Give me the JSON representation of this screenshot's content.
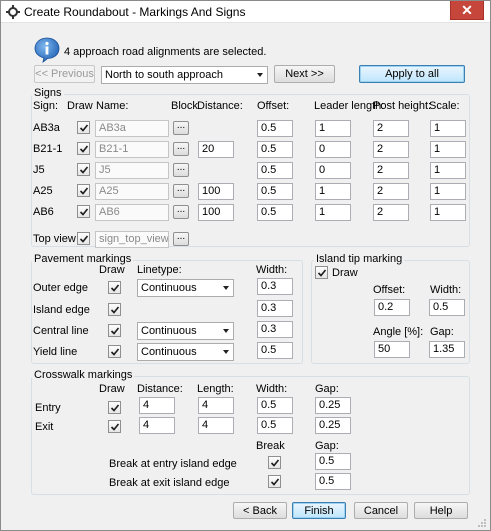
{
  "window": {
    "title": "Create Roundabout - Markings And Signs",
    "close_glyph": "✕"
  },
  "info": {
    "message": "4  approach road alignments are selected."
  },
  "nav": {
    "previous_label": "<< Previous",
    "approach_selected": "North to south approach",
    "next_label": "Next >>",
    "apply_all_label": "Apply to all"
  },
  "signs": {
    "title": "Signs",
    "headers": {
      "sign": "Sign:",
      "draw": "Draw",
      "name": "Name:",
      "block": "Block",
      "distance": "Distance:",
      "offset": "Offset:",
      "leader_length": "Leader length:",
      "post_height": "Post height:",
      "scale": "Scale:"
    },
    "rows": [
      {
        "sign": "AB3a",
        "draw": true,
        "name": "AB3a",
        "distance": "",
        "offset": "0.5",
        "leader_length": "1",
        "post_height": "2",
        "scale": "1"
      },
      {
        "sign": "B21-1",
        "draw": true,
        "name": "B21-1",
        "distance": "20",
        "offset": "0.5",
        "leader_length": "0",
        "post_height": "2",
        "scale": "1"
      },
      {
        "sign": "J5",
        "draw": true,
        "name": "J5",
        "distance": "",
        "offset": "0.5",
        "leader_length": "0",
        "post_height": "2",
        "scale": "1"
      },
      {
        "sign": "A25",
        "draw": true,
        "name": "A25",
        "distance": "100",
        "offset": "0.5",
        "leader_length": "1",
        "post_height": "2",
        "scale": "1"
      },
      {
        "sign": "AB6",
        "draw": true,
        "name": "AB6",
        "distance": "100",
        "offset": "0.5",
        "leader_length": "1",
        "post_height": "2",
        "scale": "1"
      }
    ],
    "top_view": {
      "label": "Top view",
      "draw": true,
      "name": "sign_top_view"
    },
    "block_button_label": "..."
  },
  "pavement": {
    "title": "Pavement markings",
    "headers": {
      "draw": "Draw",
      "linetype": "Linetype:",
      "width": "Width:"
    },
    "rows": [
      {
        "label": "Outer edge",
        "draw": true,
        "linetype": "Continuous",
        "width": "0.3"
      },
      {
        "label": "Island edge",
        "draw": true,
        "linetype": "",
        "width": "0.3"
      },
      {
        "label": "Central line",
        "draw": true,
        "linetype": "Continuous",
        "width": "0.3"
      },
      {
        "label": "Yield line",
        "draw": true,
        "linetype": "Continuous",
        "width": "0.5"
      }
    ]
  },
  "island_tip": {
    "title": "Island tip marking",
    "draw_label": "Draw",
    "draw": true,
    "offset_label": "Offset:",
    "offset": "0.2",
    "width_label": "Width:",
    "width": "0.5",
    "angle_label": "Angle [%]:",
    "angle": "50",
    "gap_label": "Gap:",
    "gap": "1.35"
  },
  "crosswalk": {
    "title": "Crosswalk markings",
    "headers": {
      "draw": "Draw",
      "distance": "Distance:",
      "length": "Length:",
      "width": "Width:",
      "gap": "Gap:"
    },
    "rows": [
      {
        "label": "Entry",
        "draw": true,
        "distance": "4",
        "length": "4",
        "width": "0.5",
        "gap": "0.25"
      },
      {
        "label": "Exit",
        "draw": true,
        "distance": "4",
        "length": "4",
        "width": "0.5",
        "gap": "0.25"
      }
    ],
    "break_header": "Break",
    "break_gap_header": "Gap:",
    "break_entry_label": "Break at entry island edge",
    "break_entry": true,
    "break_entry_gap": "0.5",
    "break_exit_label": "Break at exit island edge",
    "break_exit": true,
    "break_exit_gap": "0.5"
  },
  "footer": {
    "back_label": "< Back",
    "finish_label": "Finish",
    "cancel_label": "Cancel",
    "help_label": "Help"
  }
}
